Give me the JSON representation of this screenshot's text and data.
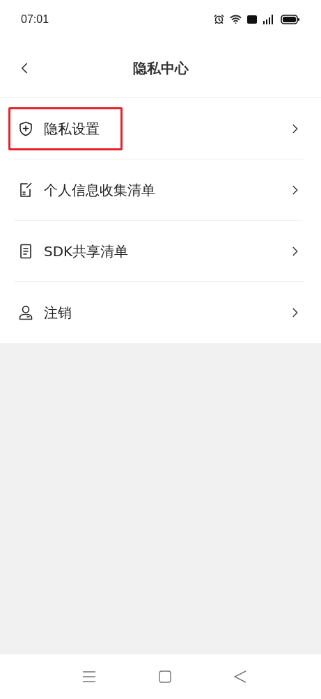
{
  "status_bar": {
    "time": "07:01"
  },
  "header": {
    "title": "隐私中心"
  },
  "items": [
    {
      "kind": "shield",
      "label": "隐私设置",
      "highlighted": true
    },
    {
      "kind": "form",
      "label": "个人信息收集清单",
      "highlighted": false
    },
    {
      "kind": "document",
      "label": "SDK共享清单",
      "highlighted": false
    },
    {
      "kind": "person",
      "label": "注销",
      "highlighted": false
    }
  ]
}
